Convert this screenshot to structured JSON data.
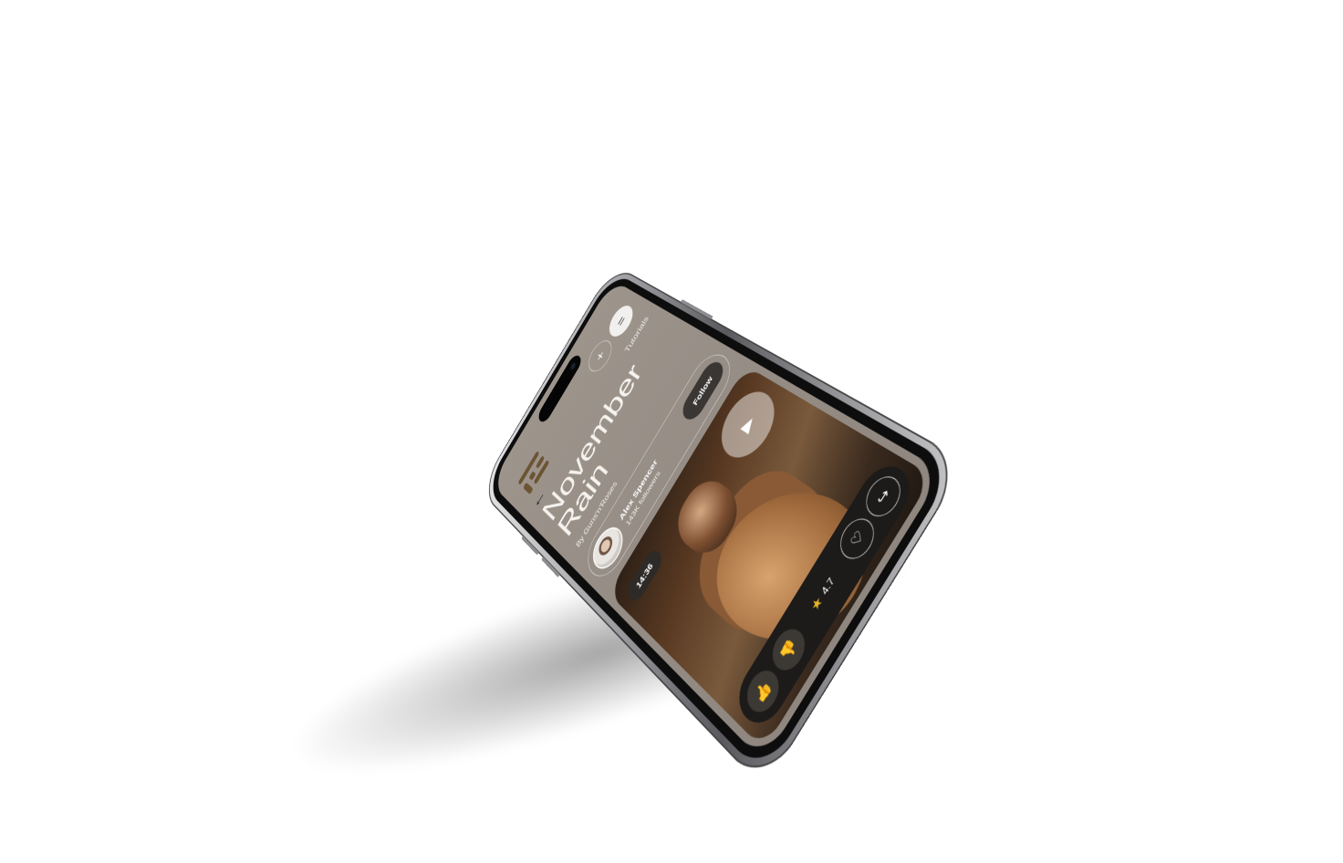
{
  "header": {
    "tab_label": "Tutorials",
    "back_glyph": "←",
    "add_glyph": "+",
    "menu_glyph": "="
  },
  "content": {
    "title": "November Rain",
    "subtitle": "By Guns'n'Roses"
  },
  "author": {
    "name": "Alex Spencer",
    "followers": "143K followers",
    "follow_label": "Follow"
  },
  "media": {
    "duration": "14:36",
    "play_glyph": "▶"
  },
  "actions": {
    "like_glyph": "👍",
    "dislike_glyph": "👎",
    "rating_value": "4.7",
    "star_glyph": "★",
    "heart_glyph": "♡",
    "share_glyph": "↪"
  },
  "colors": {
    "screen_bg": "#9d948c",
    "accent_dark": "#3a3633",
    "logo": "#6b5432",
    "star": "#e8b526"
  },
  "icons": [
    "brand-logo-icon",
    "back-arrow-icon",
    "plus-icon",
    "menu-icon",
    "play-icon",
    "thumbs-up-icon",
    "thumbs-down-icon",
    "star-icon",
    "heart-icon",
    "share-icon"
  ]
}
